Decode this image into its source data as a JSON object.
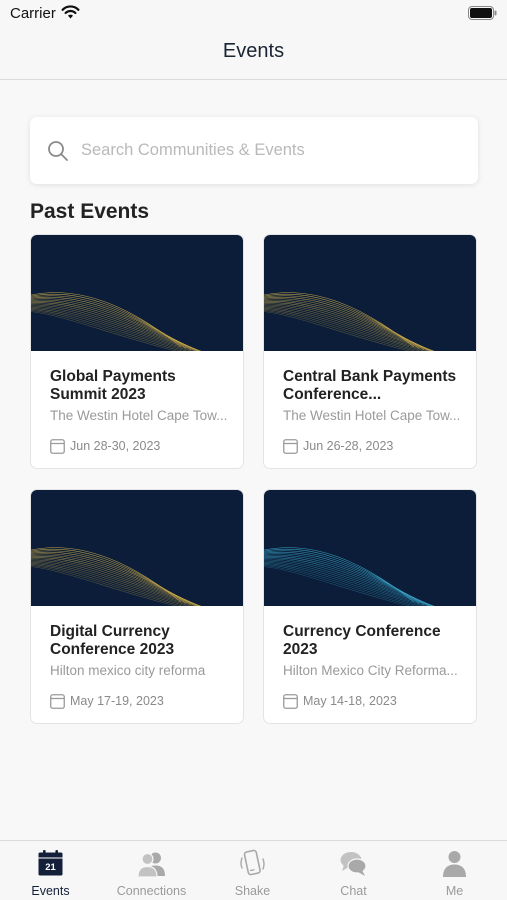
{
  "status_bar": {
    "carrier": "Carrier"
  },
  "header": {
    "title": "Events"
  },
  "search": {
    "placeholder": "Search Communities & Events"
  },
  "section": {
    "title": "Past Events"
  },
  "events": [
    {
      "title": "Global Payments Summit 2023",
      "venue": "The Westin Hotel Cape Tow...",
      "date": "Jun 28-30, 2023",
      "banner_wave_color": "#c9a94a"
    },
    {
      "title": "Central Bank Payments Conference...",
      "venue": "The Westin Hotel Cape Tow...",
      "date": "Jun 26-28, 2023",
      "banner_wave_color": "#c9a94a"
    },
    {
      "title": "Digital Currency Conference 2023",
      "venue": "Hilton mexico city reforma",
      "date": "May 17-19, 2023",
      "banner_wave_color": "#c9a94a"
    },
    {
      "title": "Currency Conference 2023",
      "venue": "Hilton Mexico City Reforma...",
      "date": "May 14-18, 2023",
      "banner_wave_color": "#3aa6c9"
    }
  ],
  "tabs": [
    {
      "label": "Events",
      "icon": "calendar-icon",
      "badge": "21",
      "active": true
    },
    {
      "label": "Connections",
      "icon": "people-icon",
      "active": false
    },
    {
      "label": "Shake",
      "icon": "shake-phone-icon",
      "active": false
    },
    {
      "label": "Chat",
      "icon": "chat-bubbles-icon",
      "active": false
    },
    {
      "label": "Me",
      "icon": "person-icon",
      "active": false
    }
  ],
  "colors": {
    "navy": "#0b1d38",
    "active_tab": "#14203a",
    "inactive_tab": "#9a9a9a"
  }
}
